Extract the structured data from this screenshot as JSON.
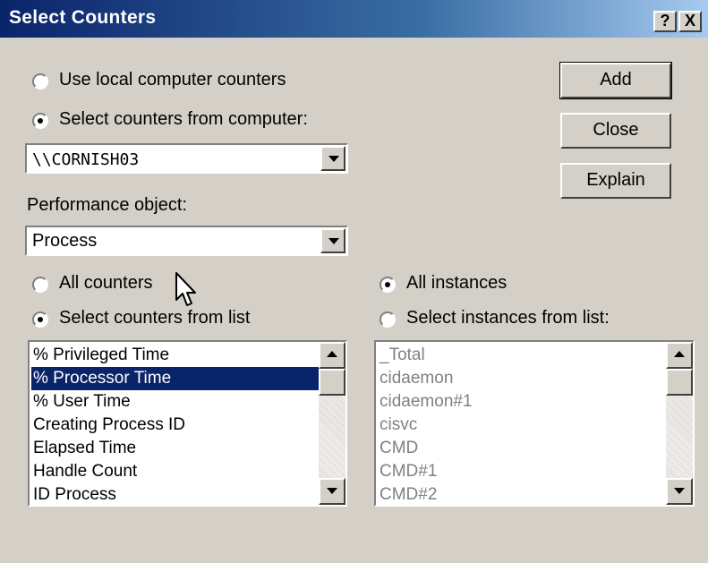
{
  "window": {
    "title": "Select Counters",
    "help_label": "?",
    "close_label": "X"
  },
  "source": {
    "local_label": "Use local computer counters",
    "remote_label": "Select counters from computer:",
    "selected": "remote",
    "computer_value": "\\\\CORNISH03"
  },
  "object": {
    "label": "Performance object:",
    "value": "Process"
  },
  "buttons": {
    "add": "Add",
    "close": "Close",
    "explain": "Explain"
  },
  "counters": {
    "all_label": "All counters",
    "list_label": "Select counters from list",
    "selected_mode": "list",
    "items": [
      "% Privileged Time",
      "% Processor Time",
      "% User Time",
      "Creating Process ID",
      "Elapsed Time",
      "Handle Count",
      "ID Process"
    ],
    "selected_item": "% Processor Time"
  },
  "instances": {
    "all_label": "All instances",
    "list_label": "Select instances from list:",
    "selected_mode": "all",
    "items": [
      "_Total",
      "cidaemon",
      "cidaemon#1",
      "cisvc",
      "CMD",
      "CMD#1",
      "CMD#2"
    ]
  }
}
